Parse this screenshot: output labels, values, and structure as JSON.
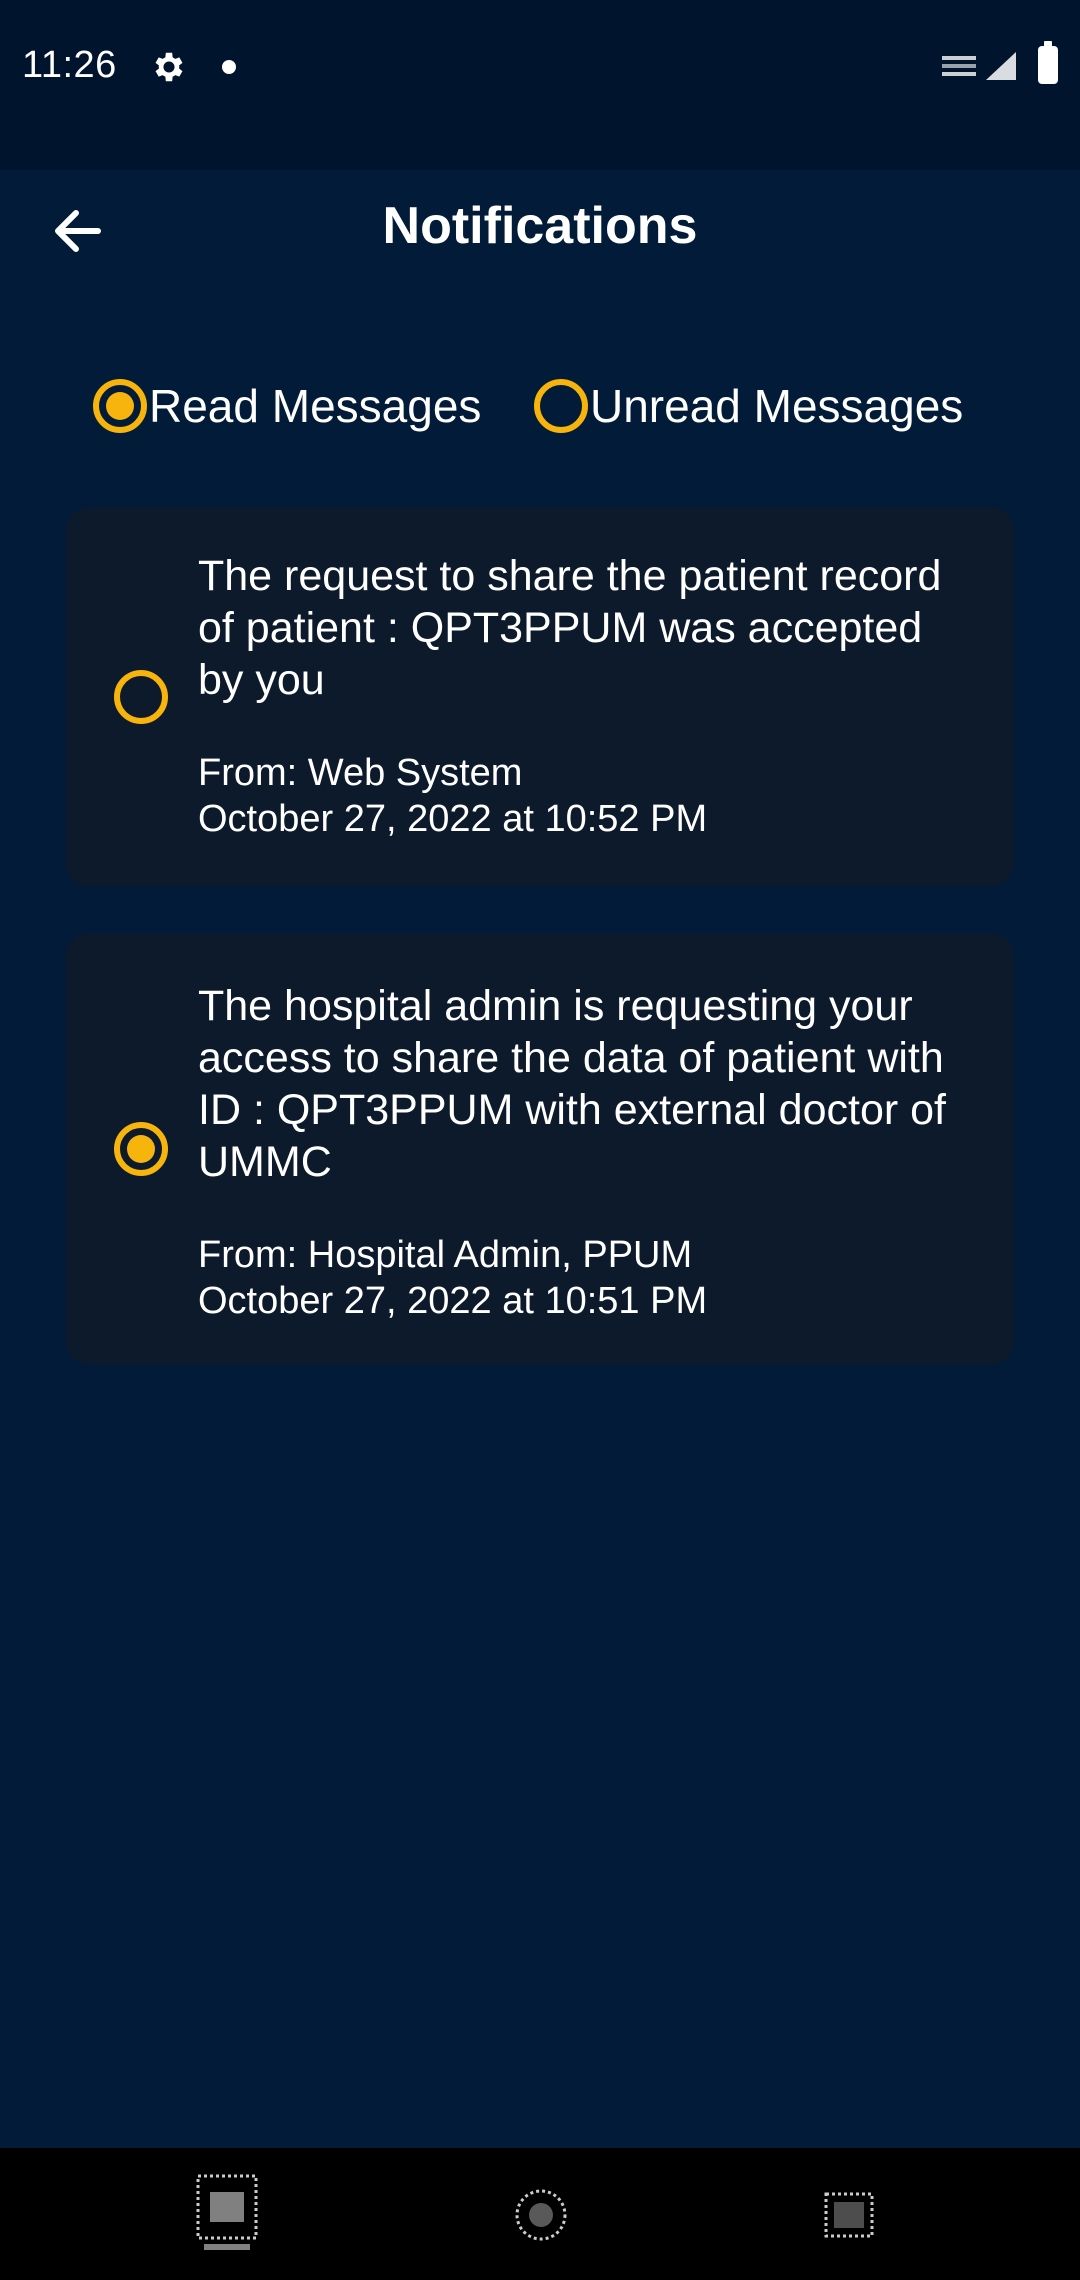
{
  "status_bar": {
    "time": "11:26",
    "icons": [
      "gear-icon",
      "notification-dot-icon",
      "signal-icon",
      "battery-icon"
    ]
  },
  "app_bar": {
    "title": "Notifications",
    "back_icon": "arrow-left-icon"
  },
  "filters": {
    "options": [
      {
        "label": "Read Messages",
        "selected": true
      },
      {
        "label": "Unread Messages",
        "selected": false
      }
    ]
  },
  "notifications": [
    {
      "message": "The request to share the patient record of patient : QPT3PPUM was accepted by you",
      "from": "From: Web System",
      "date": "October 27, 2022 at 10:52 PM",
      "selected": false
    },
    {
      "message": "The hospital admin is requesting your access to share the data of patient with ID : QPT3PPUM with external doctor of UMMC",
      "from": "From: Hospital Admin, PPUM",
      "date": "October 27, 2022 at 10:51 PM",
      "selected": true
    }
  ],
  "nav_bar": {
    "buttons": [
      "recent-apps-icon",
      "home-icon",
      "back-nav-icon"
    ]
  },
  "colors": {
    "background": "#011b38",
    "status_bar": "#01142e",
    "card": "#0d1a2c",
    "accent": "#f7b40d"
  }
}
